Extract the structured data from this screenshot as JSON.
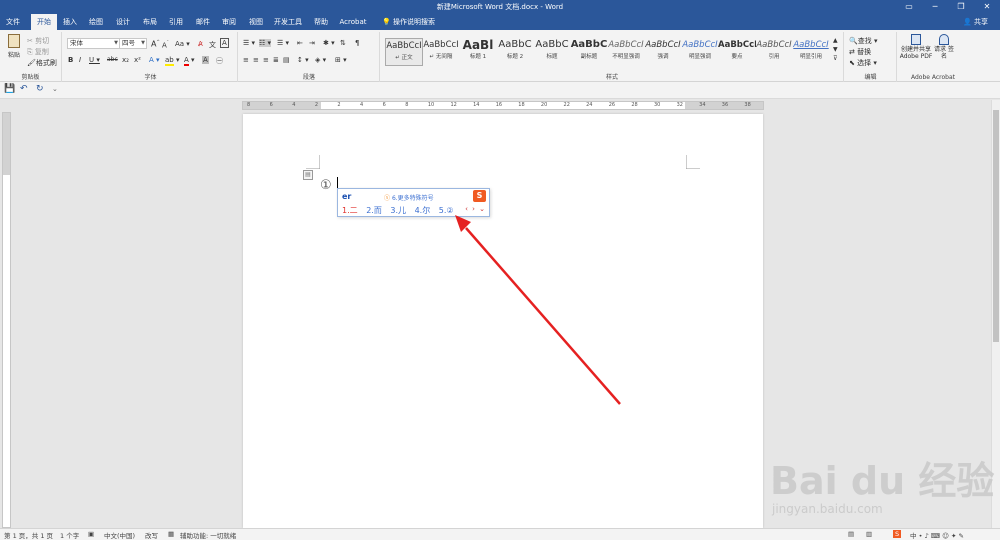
{
  "window": {
    "title": "新建Microsoft Word 文档.docx - Word",
    "controls": [
      "▭",
      "─",
      "❐",
      "✕"
    ]
  },
  "tabs": [
    {
      "label": "文件",
      "active": false
    },
    {
      "label": "开始",
      "active": true
    },
    {
      "label": "插入",
      "active": false
    },
    {
      "label": "绘图",
      "active": false
    },
    {
      "label": "设计",
      "active": false
    },
    {
      "label": "布局",
      "active": false
    },
    {
      "label": "引用",
      "active": false
    },
    {
      "label": "邮件",
      "active": false
    },
    {
      "label": "审阅",
      "active": false
    },
    {
      "label": "视图",
      "active": false
    },
    {
      "label": "开发工具",
      "active": false
    },
    {
      "label": "帮助",
      "active": false
    },
    {
      "label": "Acrobat",
      "active": false
    }
  ],
  "tell_me": "操作说明搜索",
  "share": "共享",
  "clipboard": {
    "paste": "粘贴",
    "cut": "剪切",
    "copy": "复制",
    "format_painter": "格式刷",
    "label": "剪贴板"
  },
  "font": {
    "name": "宋体",
    "size": "四号",
    "label": "字体",
    "buttons": [
      "B",
      "I",
      "U",
      "abc",
      "x₂",
      "x²",
      "A",
      "A",
      "Aa",
      "A"
    ]
  },
  "paragraph": {
    "label": "段落"
  },
  "styles": {
    "label": "样式",
    "items": [
      {
        "sample": "AaBbCcI",
        "name": "↵ 正文",
        "selected": true
      },
      {
        "sample": "AaBbCcI",
        "name": "↵ 无间隔",
        "selected": false
      },
      {
        "sample": "AaBl",
        "name": "标题 1",
        "selected": false
      },
      {
        "sample": "AaBbC",
        "name": "标题 2",
        "selected": false
      },
      {
        "sample": "AaBbC",
        "name": "标题",
        "selected": false
      },
      {
        "sample": "AaBbC",
        "name": "副标题",
        "selected": false
      },
      {
        "sample": "AaBbCcI",
        "name": "不明显强调",
        "selected": false
      },
      {
        "sample": "AaBbCcI",
        "name": "强调",
        "selected": false
      },
      {
        "sample": "AaBbCcI",
        "name": "明显强调",
        "selected": false
      },
      {
        "sample": "AaBbCcI",
        "name": "要点",
        "selected": false
      },
      {
        "sample": "AaBbCcI",
        "name": "引用",
        "selected": false
      },
      {
        "sample": "AaBbCcI",
        "name": "明显引用",
        "selected": false
      }
    ]
  },
  "editing": {
    "label": "编辑",
    "find": "查找",
    "replace": "替换",
    "select": "选择"
  },
  "acrobat": {
    "label": "Adobe Acrobat",
    "create_share": "创建并共享 Adobe PDF",
    "request_sign": "请求 签名"
  },
  "ruler": {
    "numbers": [
      "8",
      "6",
      "4",
      "2",
      "2",
      "4",
      "6",
      "8",
      "10",
      "12",
      "14",
      "16",
      "18",
      "20",
      "22",
      "24",
      "26",
      "28",
      "30",
      "32",
      "34",
      "36",
      "38"
    ]
  },
  "document": {
    "circled_char": "①"
  },
  "ime": {
    "input": "er",
    "hint": "6.更多特殊符号",
    "hint_icon": "ⓢ",
    "logo": "S",
    "candidates": [
      "1.二",
      "2.而",
      "3.儿",
      "4.尔",
      "5.②"
    ],
    "nav": "‹ › ⌄"
  },
  "status": {
    "page": "第 1 页，共 1 页",
    "words": "1 个字",
    "language": "中文(中国)",
    "mode": "改写",
    "accessibility": "辅助功能: 一切就绪"
  },
  "watermark": {
    "brand": "Bai du 经验",
    "url": "jingyan.baidu.com"
  },
  "colors": {
    "word_blue": "#2b579a",
    "ime_blue": "#3b6fd1",
    "ime_red": "#e0312c",
    "arrow_red": "#e52121"
  }
}
